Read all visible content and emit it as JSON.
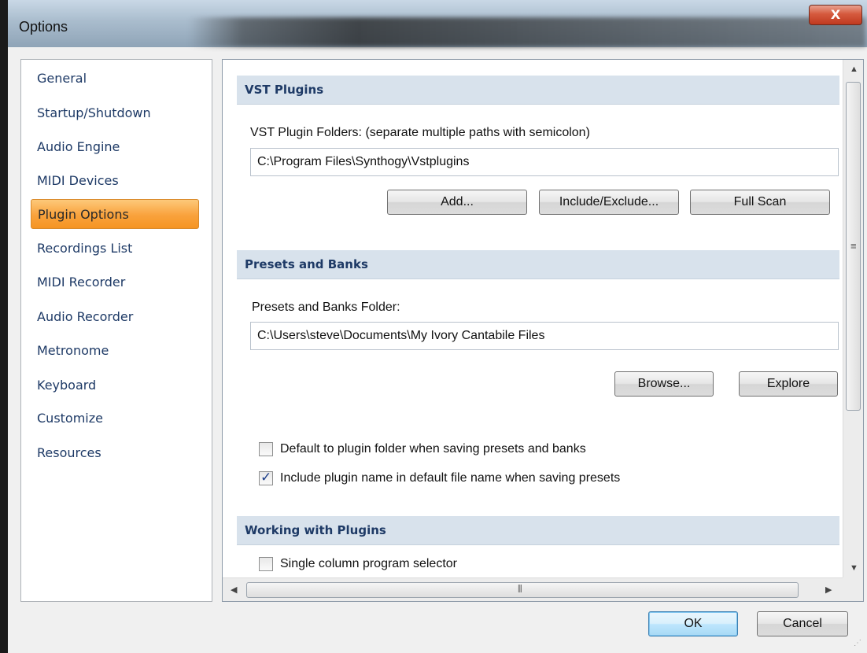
{
  "window": {
    "title": "Options",
    "close_glyph": "X"
  },
  "sidebar": {
    "items": [
      {
        "label": "General"
      },
      {
        "label": "Startup/Shutdown"
      },
      {
        "label": "Audio Engine"
      },
      {
        "label": "MIDI Devices"
      },
      {
        "label": "Plugin Options",
        "selected": true
      },
      {
        "label": "Recordings List"
      },
      {
        "label": "MIDI Recorder"
      },
      {
        "label": "Audio Recorder"
      },
      {
        "label": "Metronome"
      },
      {
        "label": "Keyboard"
      },
      {
        "label": "Customize"
      },
      {
        "label": "Resources"
      }
    ]
  },
  "vst": {
    "header": "VST Plugins",
    "folders_label": "VST Plugin Folders: (separate multiple paths with semicolon)",
    "folders_value": "C:\\Program Files\\Synthogy\\Vstplugins",
    "add_label": "Add...",
    "include_exclude_label": "Include/Exclude...",
    "full_scan_label": "Full Scan"
  },
  "presets": {
    "header": "Presets and Banks",
    "folder_label": "Presets and Banks Folder:",
    "folder_value": "C:\\Users\\steve\\Documents\\My Ivory Cantabile Files",
    "browse_label": "Browse...",
    "explore_label": "Explore",
    "default_folder_label": "Default to plugin folder when saving presets and banks",
    "default_folder_checked": false,
    "include_name_label": "Include plugin name in default file name when saving presets",
    "include_name_checked": true
  },
  "working": {
    "header": "Working with Plugins",
    "single_column_label": "Single column program selector",
    "single_column_checked": false
  },
  "footer": {
    "ok_label": "OK",
    "cancel_label": "Cancel"
  },
  "colors": {
    "selected_item": "#f9a23c",
    "section_header_bg": "#d8e2ec",
    "nav_text": "#1e3a66"
  }
}
